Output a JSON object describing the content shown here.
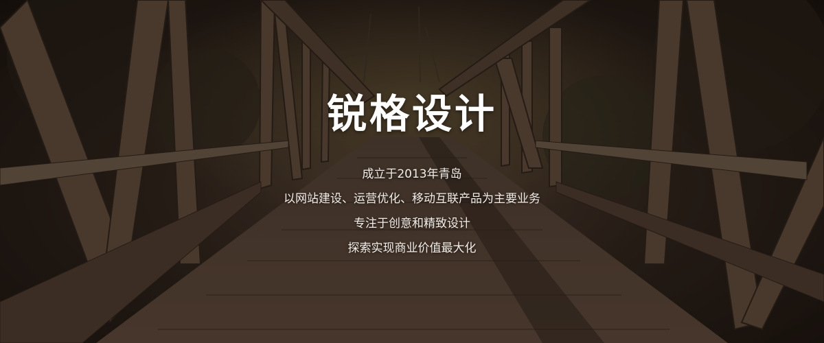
{
  "hero": {
    "title": "锐格设计",
    "lines": [
      "成立于2013年青岛",
      "以网站建设、运营优化、移动互联产品为主要业务",
      "专注于创意和精致设计",
      "探索实现商业价值最大化"
    ]
  }
}
